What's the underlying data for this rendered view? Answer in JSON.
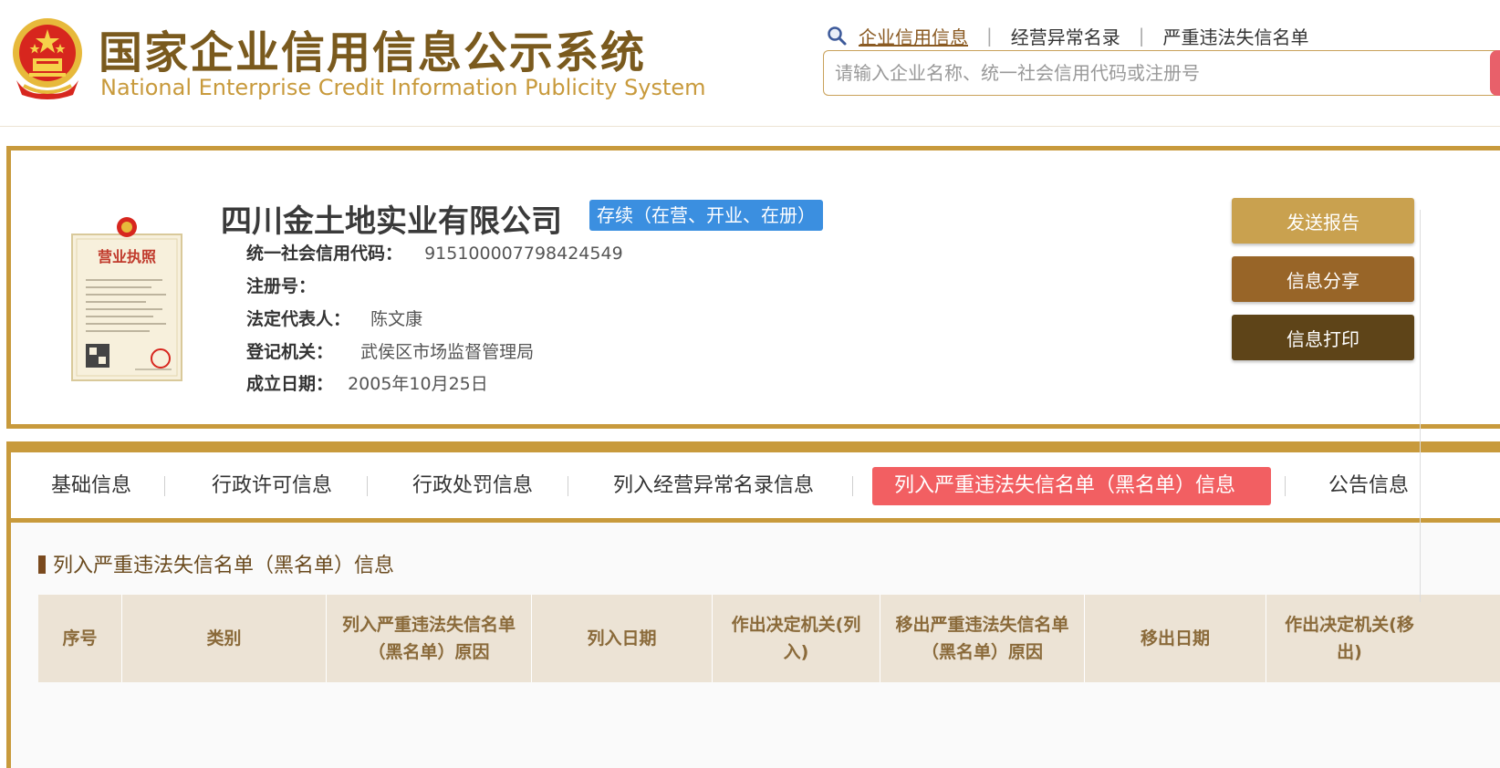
{
  "header": {
    "title_cn": "国家企业信用信息公示系统",
    "title_en": "National Enterprise Credit Information Publicity System",
    "nav": [
      {
        "label": "企业信用信息",
        "active": true
      },
      {
        "label": "经营异常名录",
        "active": false
      },
      {
        "label": "严重违法失信名单",
        "active": false
      }
    ],
    "search_placeholder": "请输入企业名称、统一社会信用代码或注册号"
  },
  "license_image": {
    "title": "营业执照"
  },
  "company": {
    "name": "四川金土地实业有限公司",
    "status": "存续（在营、开业、在册）",
    "fields": [
      {
        "label": "统一社会信用代码：",
        "value": "915100007798424549"
      },
      {
        "label": "注册号：",
        "value": ""
      },
      {
        "label": "法定代表人：",
        "value": "陈文康"
      },
      {
        "label": "登记机关：",
        "value": "武侯区市场监督管理局"
      },
      {
        "label": "成立日期：",
        "value": "2005年10月25日"
      }
    ]
  },
  "actions": {
    "send_report": "发送报告",
    "share": "信息分享",
    "print": "信息打印"
  },
  "tabs": [
    {
      "label": "基础信息",
      "active": false
    },
    {
      "label": "行政许可信息",
      "active": false
    },
    {
      "label": "行政处罚信息",
      "active": false
    },
    {
      "label": "列入经营异常名录信息",
      "active": false
    },
    {
      "label": "列入严重违法失信名单（黑名单）信息",
      "active": true
    },
    {
      "label": "公告信息",
      "active": false
    }
  ],
  "section": {
    "title": "列入严重违法失信名单（黑名单）信息",
    "columns": [
      "序号",
      "类别",
      "列入严重违法失信名单（黑名单）原因",
      "列入日期",
      "作出决定机关(列入)",
      "移出严重违法失信名单（黑名单）原因",
      "移出日期",
      "作出决定机关(移出)"
    ]
  },
  "colors": {
    "gold": "#c89a3c",
    "brown_title": "#7a5a1e",
    "active_tab": "#f25f62",
    "status_blue": "#3b8fe0",
    "btn_send": "#c9a14f",
    "btn_share": "#986528",
    "btn_print": "#5e4418"
  },
  "icons": {
    "emblem": "national-emblem-icon",
    "search": "search-icon",
    "license": "business-license-icon"
  }
}
